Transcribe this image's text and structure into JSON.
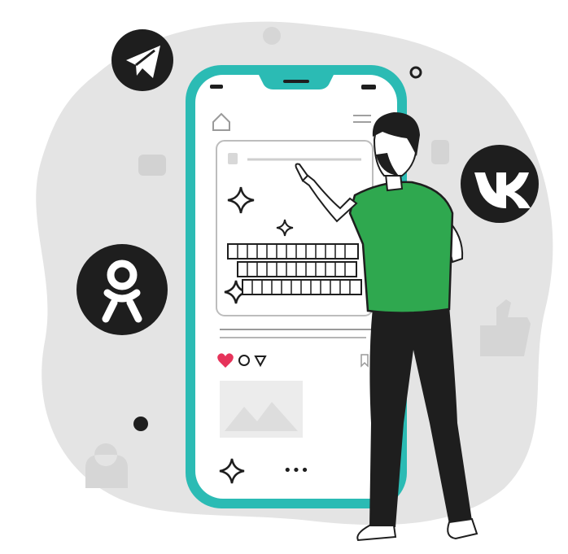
{
  "illustration": {
    "theme": "social media phone illustration",
    "colors": {
      "blob": "#e4e4e4",
      "phone_frame": "#2bbbb4",
      "shirt": "#2fa84f",
      "dark": "#1e1e1e",
      "heart": "#e6335a"
    },
    "icons": [
      "telegram-icon",
      "vk-icon",
      "odnoklassniki-icon",
      "heart-icon",
      "comment-icon",
      "share-icon",
      "bookmark-icon",
      "home-icon",
      "menu-icon",
      "sparkle-icon",
      "more-dots-icon"
    ],
    "feed": {
      "more_dots": "•••"
    }
  }
}
